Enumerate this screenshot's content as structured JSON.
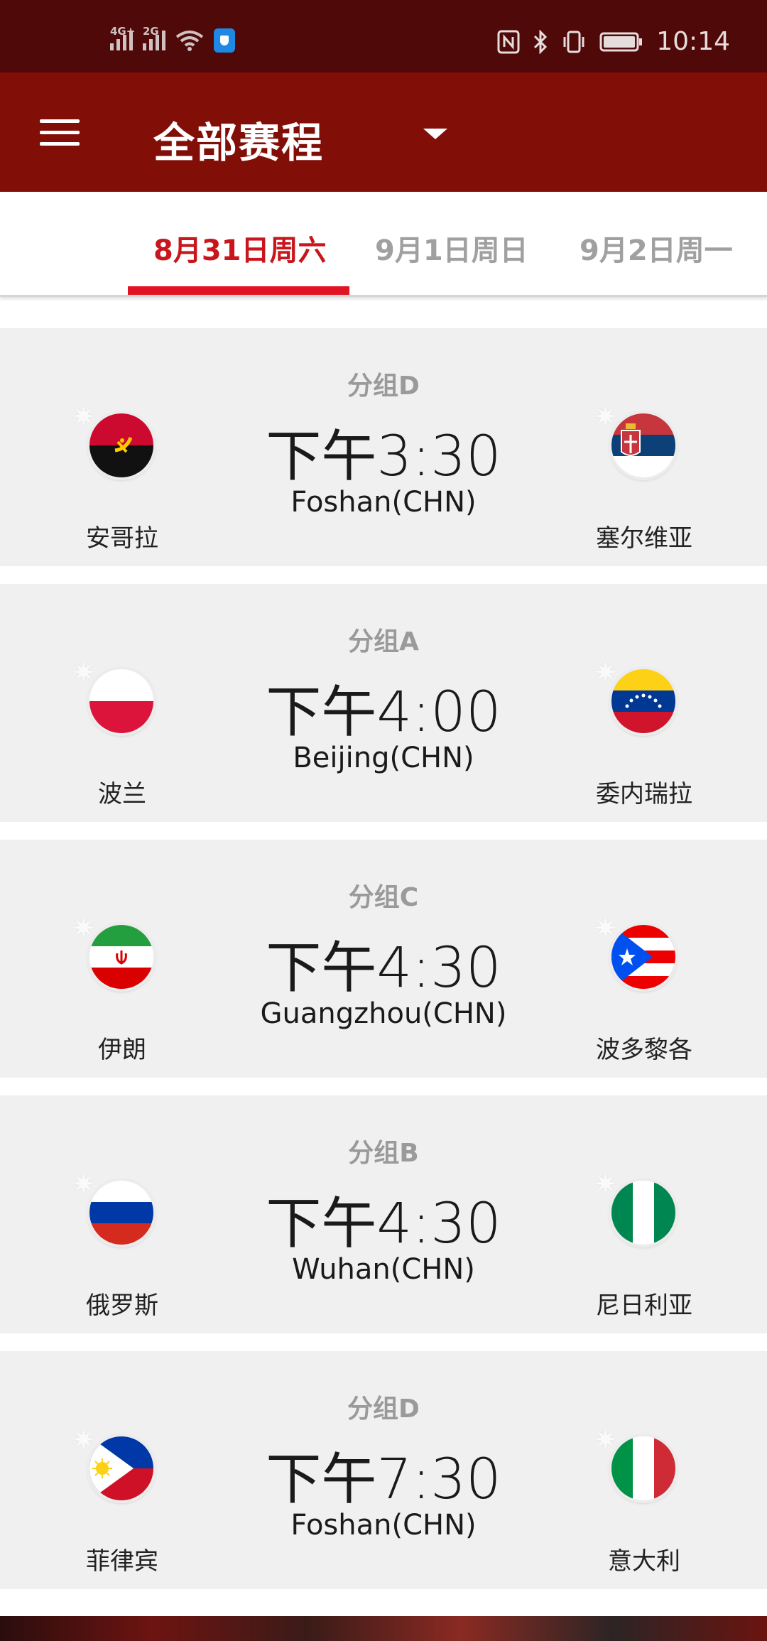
{
  "status_bar": {
    "signal1_label": "4G+",
    "signal2_label": "2G",
    "time": "10:14"
  },
  "app_bar": {
    "title": "全部赛程"
  },
  "tabs": [
    {
      "label": "8月31日周六",
      "active": true
    },
    {
      "label": "9月1日周日",
      "active": false
    },
    {
      "label": "9月2日周一",
      "active": false
    }
  ],
  "matches": [
    {
      "group": "分组D",
      "time": "下午3:30",
      "city": "Foshan(CHN)",
      "home": "安哥拉",
      "away": "塞尔维亚",
      "home_flag": "angola-flag",
      "away_flag": "serbia-flag"
    },
    {
      "group": "分组A",
      "time": "下午4:00",
      "city": "Beijing(CHN)",
      "home": "波兰",
      "away": "委内瑞拉",
      "home_flag": "poland-flag",
      "away_flag": "venezuela-flag"
    },
    {
      "group": "分组C",
      "time": "下午4:30",
      "city": "Guangzhou(CHN)",
      "home": "伊朗",
      "away": "波多黎各",
      "home_flag": "iran-flag",
      "away_flag": "puerto-rico-flag"
    },
    {
      "group": "分组B",
      "time": "下午4:30",
      "city": "Wuhan(CHN)",
      "home": "俄罗斯",
      "away": "尼日利亚",
      "home_flag": "russia-flag",
      "away_flag": "nigeria-flag"
    },
    {
      "group": "分组D",
      "time": "下午7:30",
      "city": "Foshan(CHN)",
      "home": "菲律宾",
      "away": "意大利",
      "home_flag": "philippines-flag",
      "away_flag": "italy-flag"
    }
  ],
  "colors": {
    "status_bar": "#4f0908",
    "app_bar": "#820e08",
    "accent": "#e01422",
    "card": "#f0f0f0"
  }
}
